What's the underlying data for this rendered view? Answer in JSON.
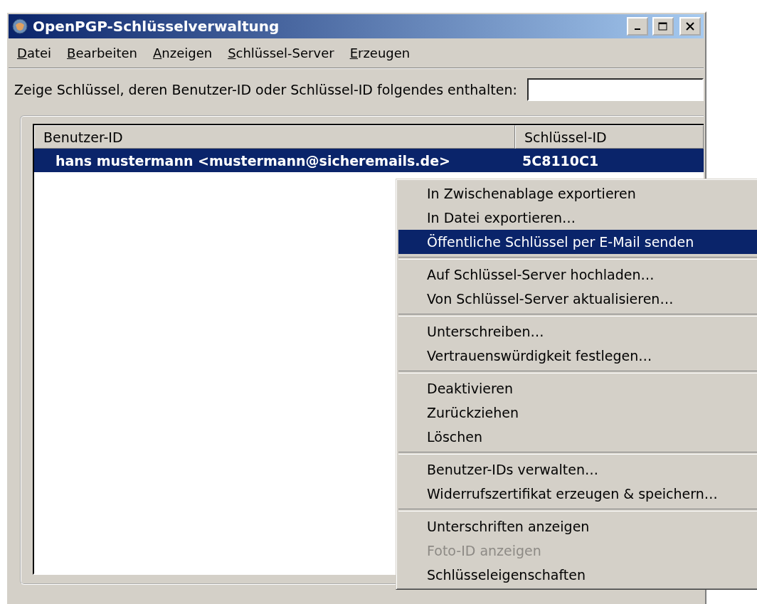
{
  "window": {
    "title": "OpenPGP-Schlüsselverwaltung"
  },
  "menu_bar": [
    {
      "label": "Datei"
    },
    {
      "label": "Bearbeiten"
    },
    {
      "label": "Anzeigen"
    },
    {
      "label": "Schlüssel-Server"
    },
    {
      "label": "Erzeugen"
    }
  ],
  "filter": {
    "label": "Zeige Schlüssel, deren Benutzer-ID oder Schlüssel-ID folgendes enthalten:"
  },
  "key_list": {
    "columns": [
      "Benutzer-ID",
      "Schlüssel-ID"
    ],
    "rows": [
      {
        "user_id": "hans mustermann <mustermann@sicheremails.de>",
        "key_id": "5C8110C1",
        "selected": true
      }
    ]
  },
  "context_menu": {
    "groups": [
      [
        {
          "label": "In Zwischenablage exportieren",
          "selected": false,
          "disabled": false
        },
        {
          "label": "In Datei exportieren…",
          "selected": false,
          "disabled": false
        },
        {
          "label": "Öffentliche Schlüssel per E-Mail senden",
          "selected": true,
          "disabled": false
        }
      ],
      [
        {
          "label": "Auf Schlüssel-Server hochladen…",
          "selected": false,
          "disabled": false
        },
        {
          "label": "Von Schlüssel-Server aktualisieren…",
          "selected": false,
          "disabled": false
        }
      ],
      [
        {
          "label": "Unterschreiben…",
          "selected": false,
          "disabled": false
        },
        {
          "label": "Vertrauenswürdigkeit festlegen…",
          "selected": false,
          "disabled": false
        }
      ],
      [
        {
          "label": "Deaktivieren",
          "selected": false,
          "disabled": false
        },
        {
          "label": "Zurückziehen",
          "selected": false,
          "disabled": false
        },
        {
          "label": "Löschen",
          "selected": false,
          "disabled": false
        }
      ],
      [
        {
          "label": "Benutzer-IDs verwalten…",
          "selected": false,
          "disabled": false
        },
        {
          "label": "Widerrufszertifikat erzeugen & speichern…",
          "selected": false,
          "disabled": false
        }
      ],
      [
        {
          "label": "Unterschriften anzeigen",
          "selected": false,
          "disabled": false
        },
        {
          "label": "Foto-ID anzeigen",
          "selected": false,
          "disabled": true
        },
        {
          "label": "Schlüsseleigenschaften",
          "selected": false,
          "disabled": false
        }
      ]
    ]
  }
}
